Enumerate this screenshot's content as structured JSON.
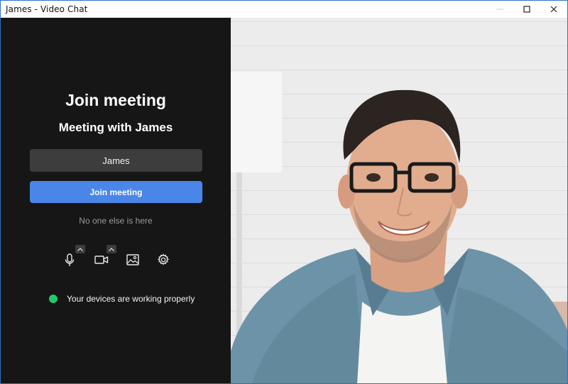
{
  "window": {
    "title": "James - Video Chat",
    "controls": {
      "minimize": "minimize-icon",
      "maximize": "maximize-icon",
      "close": "close-icon"
    }
  },
  "join": {
    "heading": "Join meeting",
    "subheading": "Meeting with James",
    "name_value": "James",
    "join_button": "Join meeting",
    "empty_text": "No one else is here"
  },
  "controls": [
    {
      "name": "microphone-icon",
      "has_menu": true
    },
    {
      "name": "camera-icon",
      "has_menu": true
    },
    {
      "name": "background-image-icon",
      "has_menu": false
    },
    {
      "name": "settings-gear-icon",
      "has_menu": false
    }
  ],
  "status": {
    "text": "Your devices are working properly",
    "color": "#1fc96b"
  },
  "colors": {
    "panel_bg": "#161616",
    "input_bg": "#3d3d3d",
    "accent": "#4a86e8",
    "window_border": "#2b73c9"
  }
}
